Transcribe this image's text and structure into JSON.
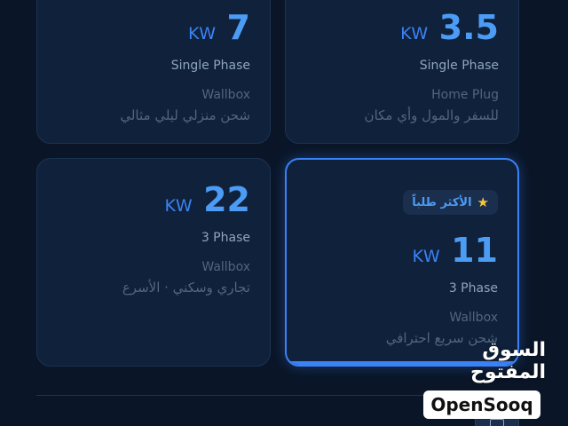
{
  "cards": [
    {
      "value": "3.5",
      "unit": "KW",
      "phase": "Single Phase",
      "type": "Home Plug",
      "desc": "للسفر والمول وأي مكان"
    },
    {
      "value": "7",
      "unit": "KW",
      "phase": "Single Phase",
      "type": "Wallbox",
      "desc": "شحن منزلي ليلي مثالي"
    },
    {
      "badge": "الأكثر طلباً",
      "badge_icon": "star-icon",
      "value": "11",
      "unit": "KW",
      "phase": "3 Phase",
      "type": "Wallbox",
      "desc": "شحن سريع احترافي"
    },
    {
      "value": "22",
      "unit": "KW",
      "phase": "3 Phase",
      "type": "Wallbox",
      "desc": "تجاري وسكني · الأسرع"
    }
  ],
  "watermark": {
    "arabic": "السوق المفتوح",
    "english": "OpenSooq"
  },
  "footer_button_icon": "keyboard-icon",
  "colors": {
    "accent": "#3b82f6",
    "background": "#0a1628",
    "card": "#0f213b"
  }
}
